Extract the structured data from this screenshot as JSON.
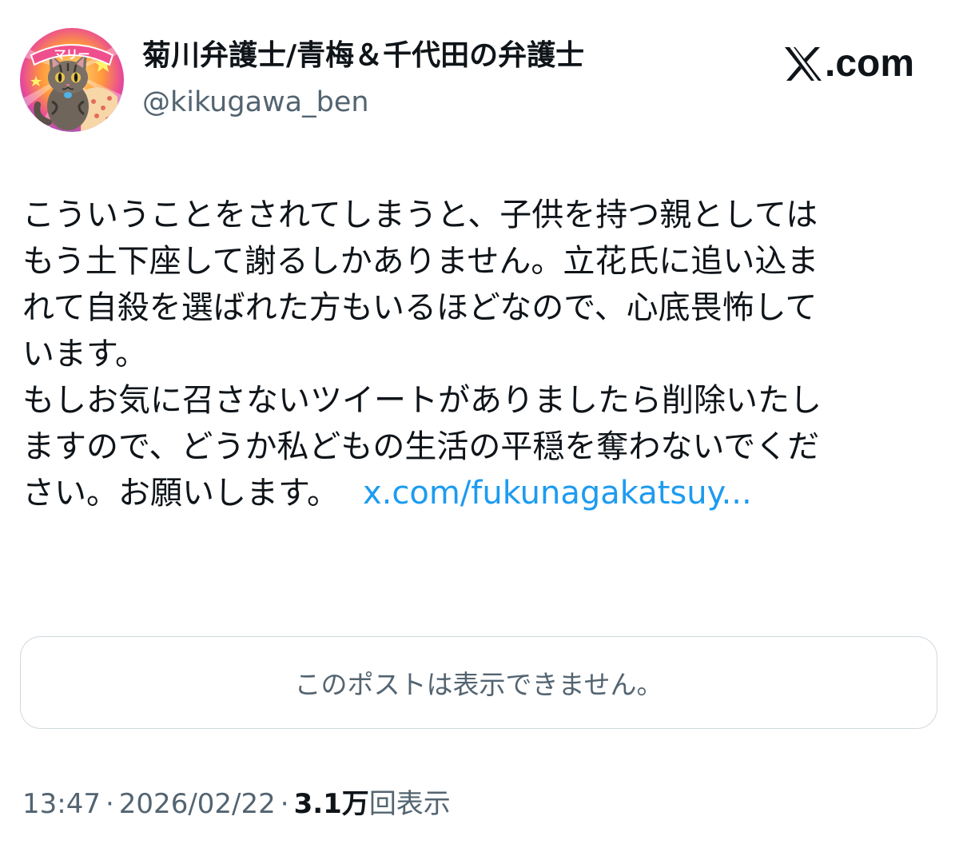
{
  "author": {
    "avatar_label": "マリー",
    "display_name": "菊川弁護士/青梅＆千代田の弁護士",
    "handle": "@kikugawa_ben"
  },
  "brand": {
    "icon": "x-logo-icon",
    "suffix": ".com"
  },
  "post": {
    "lines": [
      "こういうことをされてしまうと、子供を持つ親としては",
      "もう土下座して謝るしかありません。立花氏に追い込ま",
      "れて自殺を選ばれた方もいるほどなので、心底畏怖して",
      "います。",
      "もしお気に召さないツイートがありましたら削除いたし",
      "ますので、どうか私どもの生活の平穏を奪わないでくだ",
      "さい。お願いします。"
    ],
    "link_text": "x.com/fukunagakatsuy..."
  },
  "quote": {
    "unavailable_text": "このポストは表示できません。"
  },
  "meta": {
    "time": "13:47",
    "separator": "·",
    "date": "2026/02/22",
    "views_count": "3.1万",
    "views_label": "回表示"
  },
  "colors": {
    "text": "#0f1419",
    "secondary": "#536471",
    "link": "#1d9bf0",
    "border": "#cfd9de"
  }
}
